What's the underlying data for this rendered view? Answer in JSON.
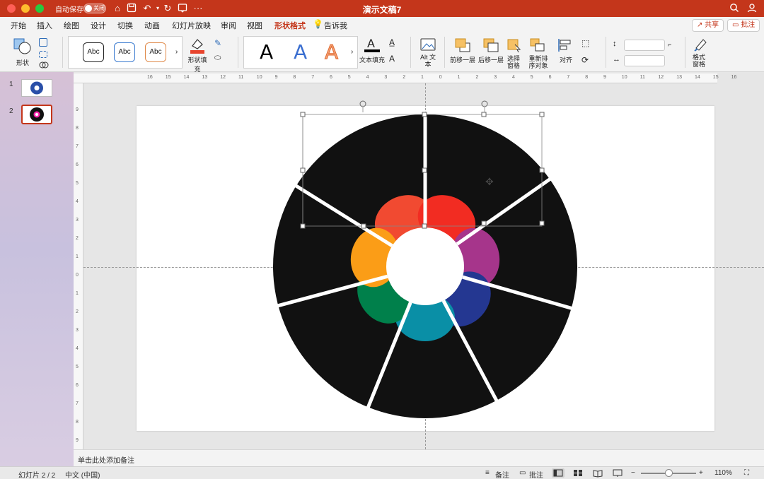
{
  "window": {
    "title": "演示文稿7",
    "autosave_label": "自动保存",
    "autosave_state": "关闭"
  },
  "tabs": [
    {
      "label": "开始"
    },
    {
      "label": "插入"
    },
    {
      "label": "绘图"
    },
    {
      "label": "设计"
    },
    {
      "label": "切换"
    },
    {
      "label": "动画"
    },
    {
      "label": "幻灯片放映"
    },
    {
      "label": "审阅"
    },
    {
      "label": "视图"
    },
    {
      "label": "形状格式"
    },
    {
      "label": "告诉我"
    }
  ],
  "active_tab": "形状格式",
  "header_buttons": {
    "share": "共享",
    "comment": "批注"
  },
  "ribbon": {
    "shape_label": "形状",
    "style_samples": [
      "Abc",
      "Abc",
      "Abc"
    ],
    "shape_fill_label": "形状填充",
    "wordart_samples": [
      "A",
      "A",
      "A"
    ],
    "text_fill_label": "文本填充",
    "alt_text_label": "Alt 文本",
    "bring_forward_label": "前移一层",
    "send_backward_label": "后移一层",
    "selection_pane_label": "选择窗格",
    "reorder_label": "重新排序对象",
    "align_label": "对齐",
    "format_pane_label": "格式窗格",
    "fill_color": "#e8442d"
  },
  "thumbnails": [
    {
      "number": "1"
    },
    {
      "number": "2"
    }
  ],
  "active_slide": 2,
  "ruler": {
    "horizontal": [
      "16",
      "15",
      "14",
      "13",
      "12",
      "11",
      "10",
      "9",
      "8",
      "7",
      "6",
      "5",
      "4",
      "3",
      "2",
      "1",
      "0",
      "1",
      "2",
      "3",
      "4",
      "5",
      "6",
      "7",
      "8",
      "9",
      "10",
      "11",
      "12",
      "13",
      "14",
      "15",
      "16"
    ],
    "vertical": [
      "9",
      "8",
      "7",
      "6",
      "5",
      "4",
      "3",
      "2",
      "1",
      "0",
      "1",
      "2",
      "3",
      "4",
      "5",
      "6",
      "7",
      "8",
      "9"
    ]
  },
  "slide_content": {
    "outer_color": "#111111",
    "divider_color": "#ffffff",
    "petals": [
      {
        "name": "red-orange",
        "color": "#f14a31"
      },
      {
        "name": "red",
        "color": "#f22c22"
      },
      {
        "name": "magenta",
        "color": "#a6358b"
      },
      {
        "name": "navy",
        "color": "#243791"
      },
      {
        "name": "teal",
        "color": "#0a8fa6"
      },
      {
        "name": "green",
        "color": "#00804b"
      },
      {
        "name": "orange",
        "color": "#fb9d17"
      }
    ]
  },
  "notes_placeholder": "单击此处添加备注",
  "status": {
    "slide_info": "幻灯片 2 / 2",
    "language": "中文 (中国)",
    "notes_label": "备注",
    "comments_label": "批注",
    "zoom": "110%"
  }
}
